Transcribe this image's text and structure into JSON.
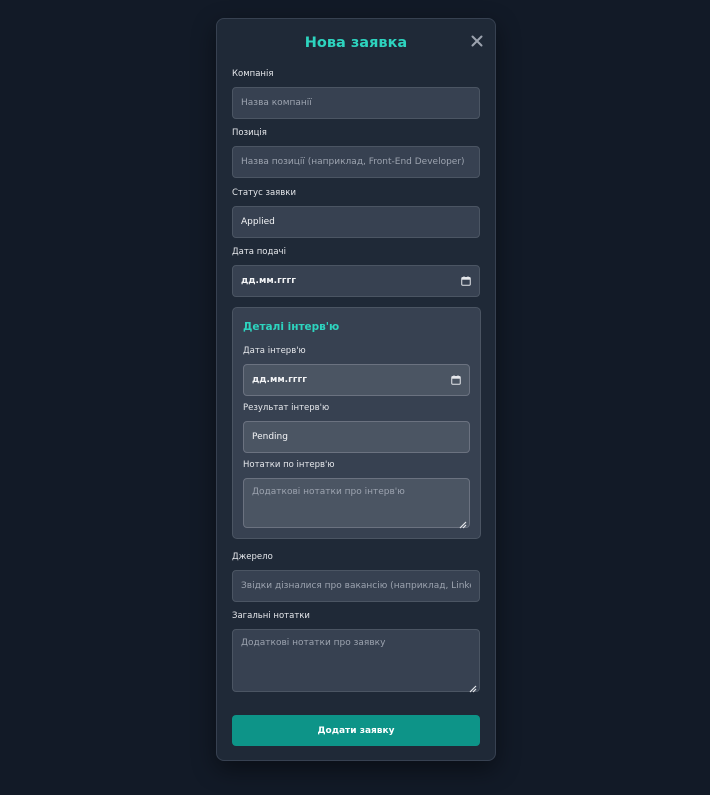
{
  "modal": {
    "title": "Нова заявка",
    "close_icon": "close-icon"
  },
  "company": {
    "label": "Компанія",
    "placeholder": "Назва компанії"
  },
  "position": {
    "label": "Позиція",
    "placeholder": "Назва позиції (наприклад, Front-End Developer)"
  },
  "status": {
    "label": "Статус заявки",
    "value": "Applied"
  },
  "apply_date": {
    "label": "Дата подачі",
    "value": "дд.мм.гггг",
    "icon": "calendar-icon"
  },
  "interview": {
    "title": "Деталі інтерв'ю",
    "date_label": "Дата інтерв'ю",
    "date_value": "дд.мм.гггг",
    "result_label": "Результат інтерв'ю",
    "result_value": "Pending",
    "notes_label": "Нотатки по інтерв'ю",
    "notes_placeholder": "Додаткові нотатки про інтерв'ю"
  },
  "source": {
    "label": "Джерело",
    "placeholder": "Звідки дізналися про вакансію (наприклад, LinkedIn)"
  },
  "general_notes": {
    "label": "Загальні нотатки",
    "placeholder": "Додаткові нотатки про заявку"
  },
  "submit": {
    "label": "Додати заявку"
  },
  "colors": {
    "background": "#121a27",
    "panel": "#1f2937",
    "accent": "#2dd4bf",
    "button": "#0d9488"
  }
}
